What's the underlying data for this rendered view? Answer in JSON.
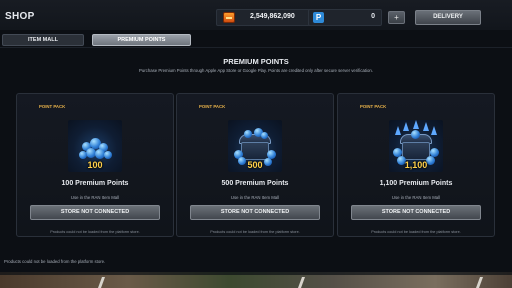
{
  "header": {
    "title": "SHOP",
    "gold_icon": "gold-ingot-icon",
    "gold_balance": "2,549,862,090",
    "points_icon": "points-p-icon",
    "points_glyph": "P",
    "points_balance": "0",
    "plus_label": "+",
    "delivery_label": "DELIVERY"
  },
  "tabs": [
    {
      "label": "ITEM MALL",
      "active": false
    },
    {
      "label": "PREMIUM POINTS",
      "active": true
    }
  ],
  "main": {
    "heading": "PREMIUM POINTS",
    "subheading": "Purchase Premium Points through Apple App Store or Google Play. Points are credited only after secure server verification."
  },
  "packs": [
    {
      "tag": "POINT PACK",
      "amount": "100",
      "name": "100 Premium Points",
      "desc": "Use in the RAN Item Mall",
      "button": "STORE NOT CONNECTED",
      "message": "Products could not be loaded from the platform store."
    },
    {
      "tag": "POINT PACK",
      "amount": "500",
      "name": "500 Premium Points",
      "desc": "Use in the RAN Item Mall",
      "button": "STORE NOT CONNECTED",
      "message": "Products could not be loaded from the platform store."
    },
    {
      "tag": "POINT PACK",
      "amount": "1,100",
      "name": "1,100 Premium Points",
      "desc": "Use in the RAN Item Mall",
      "button": "STORE NOT CONNECTED",
      "message": "Products could not be loaded from the platform store."
    }
  ],
  "footer": {
    "message": "Products could not be loaded from the platform store."
  },
  "colors": {
    "accent_gold": "#ffd04a",
    "tag_orange": "#e8b24a",
    "background": "#0c0f14"
  }
}
